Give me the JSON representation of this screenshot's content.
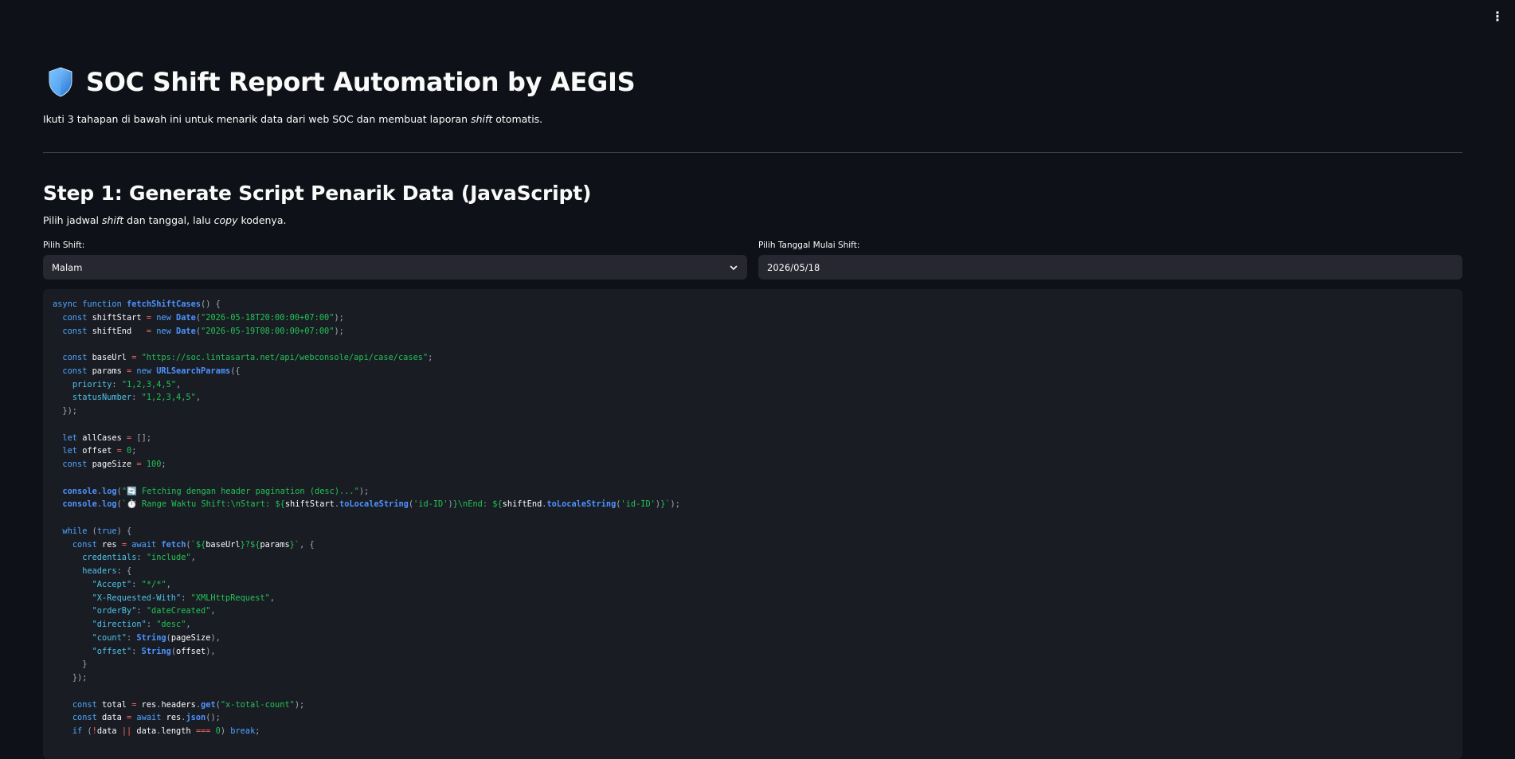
{
  "app": {
    "title": "SOC Shift Report Automation by AEGIS",
    "subtitle_pre": "Ikuti 3 tahapan di bawah ini untuk menarik data dari web SOC dan membuat laporan ",
    "subtitle_em": "shift",
    "subtitle_post": " otomatis.",
    "menu_icon": "kebab-menu-icon"
  },
  "step1": {
    "title": "Step 1: Generate Script Penarik Data (JavaScript)",
    "desc_pre": "Pilih jadwal ",
    "desc_em1": "shift",
    "desc_mid": " dan tanggal, lalu ",
    "desc_em2": "copy",
    "desc_post": " kodenya.",
    "shift_label": "Pilih Shift:",
    "shift_value": "Malam",
    "date_label": "Pilih Tanggal Mulai Shift:",
    "date_value": "2026/05/18"
  },
  "code": {
    "shift_start": "\"2026-05-18T20:00:00+07:00\"",
    "shift_end": "\"2026-05-19T08:00:00+07:00\"",
    "base_url": "\"https://soc.lintasarta.net/api/webconsole/api/case/cases\"",
    "priority": "\"1,2,3,4,5\"",
    "status_number": "\"1,2,3,4,5\"",
    "page_size": "100",
    "log1": "\"🔄 Fetching dengan header pagination (desc)...\"",
    "log2_text": "⏱️ Range Waktu Shift:\\nStart: ",
    "log2_end_text": "}\\nEnd: ",
    "locale": "'id-ID'",
    "credentials": "\"include\"",
    "accept": "\"*/*\"",
    "xrw": "\"XMLHttpRequest\"",
    "order_by": "\"dateCreated\"",
    "direction": "\"desc\"",
    "total_header": "\"x-total-count\""
  }
}
